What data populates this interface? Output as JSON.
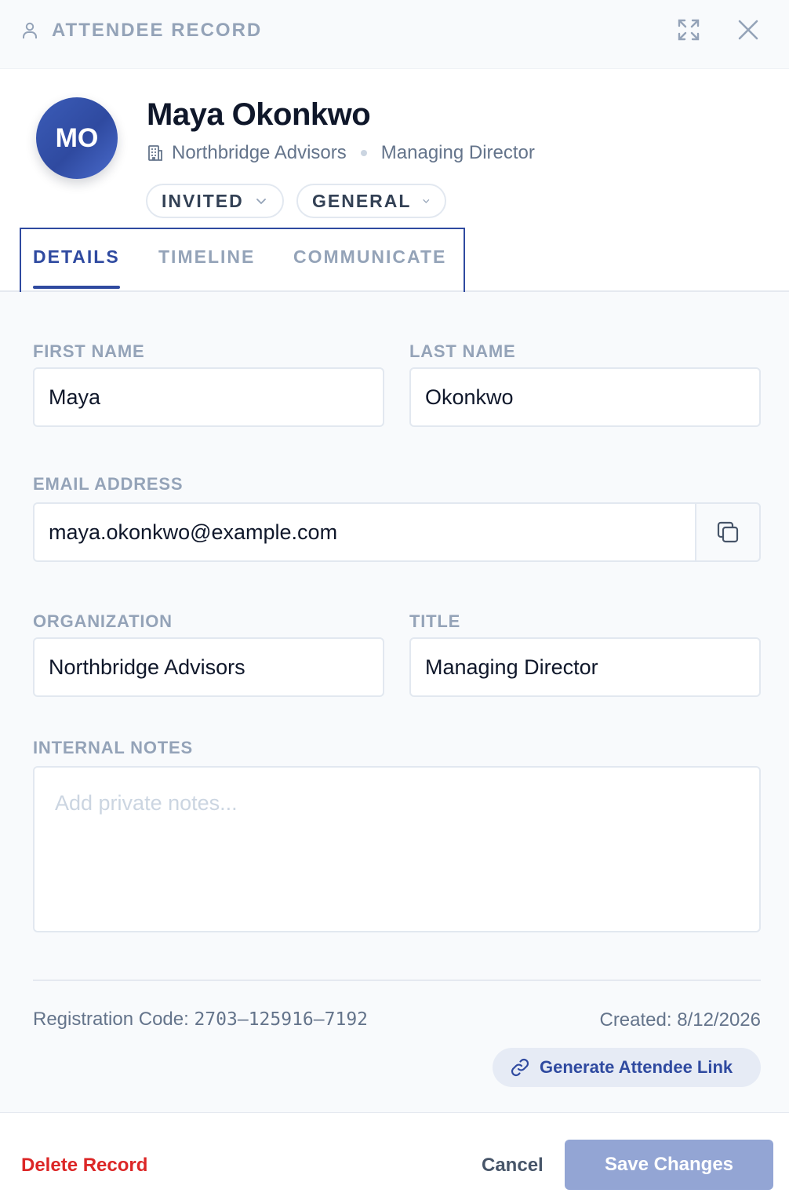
{
  "panel": {
    "title": "ATTENDEE RECORD",
    "icons": {
      "title": "person-icon",
      "expand": "expand-icon",
      "close": "close-icon"
    }
  },
  "attendee": {
    "initials": "MO",
    "name": "Maya Okonkwo",
    "organization": "Northbridge Advisors",
    "title": "Managing Director",
    "status": "INVITED",
    "type": "GENERAL"
  },
  "tabs": [
    {
      "label": "DETAILS",
      "active": true
    },
    {
      "label": "TIMELINE",
      "active": false
    },
    {
      "label": "COMMUNICATE",
      "active": false
    }
  ],
  "form": {
    "first_name": {
      "label": "FIRST NAME",
      "value": "Maya"
    },
    "last_name": {
      "label": "LAST NAME",
      "value": "Okonkwo"
    },
    "email": {
      "label": "EMAIL ADDRESS",
      "value": "maya.okonkwo@example.com"
    },
    "organization": {
      "label": "ORGANIZATION",
      "value": "Northbridge Advisors"
    },
    "title": {
      "label": "TITLE",
      "value": "Managing Director"
    },
    "notes": {
      "label": "INTERNAL NOTES",
      "value": "",
      "placeholder": "Add private notes..."
    }
  },
  "meta": {
    "registration_label": "Registration Code:",
    "registration_code": "2703–125916–7192",
    "created_label": "Created:",
    "created_date": "8/12/2026",
    "generate_link_label": "Generate Attendee Link"
  },
  "footer": {
    "delete_label": "Delete Record",
    "cancel_label": "Cancel",
    "save_label": "Save Changes"
  },
  "colors": {
    "accent": "#2f4aa0",
    "danger": "#dc2626",
    "save_disabled": "#93a5d4"
  }
}
